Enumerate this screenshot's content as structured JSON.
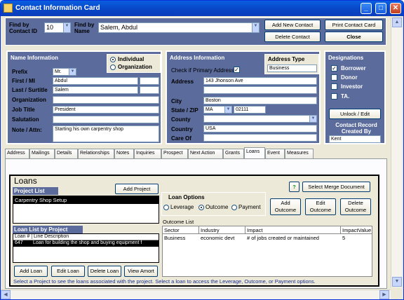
{
  "window": {
    "title": "Contact Information Card"
  },
  "header": {
    "find_id_label": "Find by Contact ID",
    "find_id_value": "10",
    "find_name_label": "Find by Name",
    "find_name_value": "Salem, Abdul",
    "add_contact": "Add New Contact",
    "print_card": "Print Contact Card",
    "delete_contact": "Delete Contact",
    "close": "Close"
  },
  "name": {
    "title": "Name Information",
    "individual": "Individual",
    "organization": "Organization",
    "prefix_label": "Prefix",
    "prefix": "Mr.",
    "first_label": "First / MI",
    "first": "Abdul",
    "last_label": "Last / Surtitle",
    "last": "Salem",
    "org_label": "Organization",
    "job_label": "Job Title",
    "job": "President",
    "salutation_label": "Salutation",
    "note_label": "Note / Attn:",
    "note": "Starting his own carpentry shop"
  },
  "address": {
    "title": "Address Information",
    "type_label": "Address Type",
    "type": "Business",
    "primary_label": "Check if Primary Address",
    "address_label": "Address",
    "address": "143 Jhonson Ave",
    "city_label": "City",
    "city": "Boston",
    "state_label": "State / ZIP",
    "state": "MA",
    "zip": "02111",
    "county_label": "County",
    "country_label": "Country",
    "country": "USA",
    "careof_label": "Care Of"
  },
  "designations": {
    "title": "Designations",
    "borrower": "Borrower",
    "donor": "Donor",
    "investor": "Investor",
    "ta": "TA.",
    "unlock": "Unlock / Edit",
    "created_label": "Contact Record Created By",
    "created_by": "Kent"
  },
  "tabs": [
    "Address",
    "Mailings",
    "Details",
    "Relationships",
    "Notes",
    "Inquiries",
    "Prospect",
    "Next Action",
    "Grants",
    "Loans",
    "Event",
    "Measures"
  ],
  "loans": {
    "title": "Loans",
    "project_list": "Project List",
    "add_project": "Add Project",
    "project": "Carpentry Shop Setup",
    "help": "?",
    "merge": "Select Merge Document",
    "options_label": "Loan Options",
    "leverage": "Leverage",
    "outcome": "Outcome",
    "payment": "Payment",
    "add_outcome": "Add Outcome",
    "edit_outcome": "Edit Outcome",
    "delete_outcome": "Delete Outcome",
    "loan_list": "Loan List by Project",
    "loan_col": "Loan #",
    "desc_col": "Line Description",
    "loan_no": "647",
    "loan_desc": "Loan for building the shop and buying equipment f",
    "outcome_list": "Outcome List",
    "out_cols": [
      "Sector",
      "Industry",
      "Impact",
      "ImpactValue"
    ],
    "out_row": [
      "Business",
      "economic devt",
      "# of jobs created or maintained",
      "5"
    ],
    "add_loan": "Add Loan",
    "edit_loan": "Edit Loan",
    "delete_loan": "Delete Loan",
    "view_amort": "View Amort",
    "hint": "Select a Project to see the loans associated with the project.  Select a loan to access the Leverage, Outcome, or Payment options."
  }
}
